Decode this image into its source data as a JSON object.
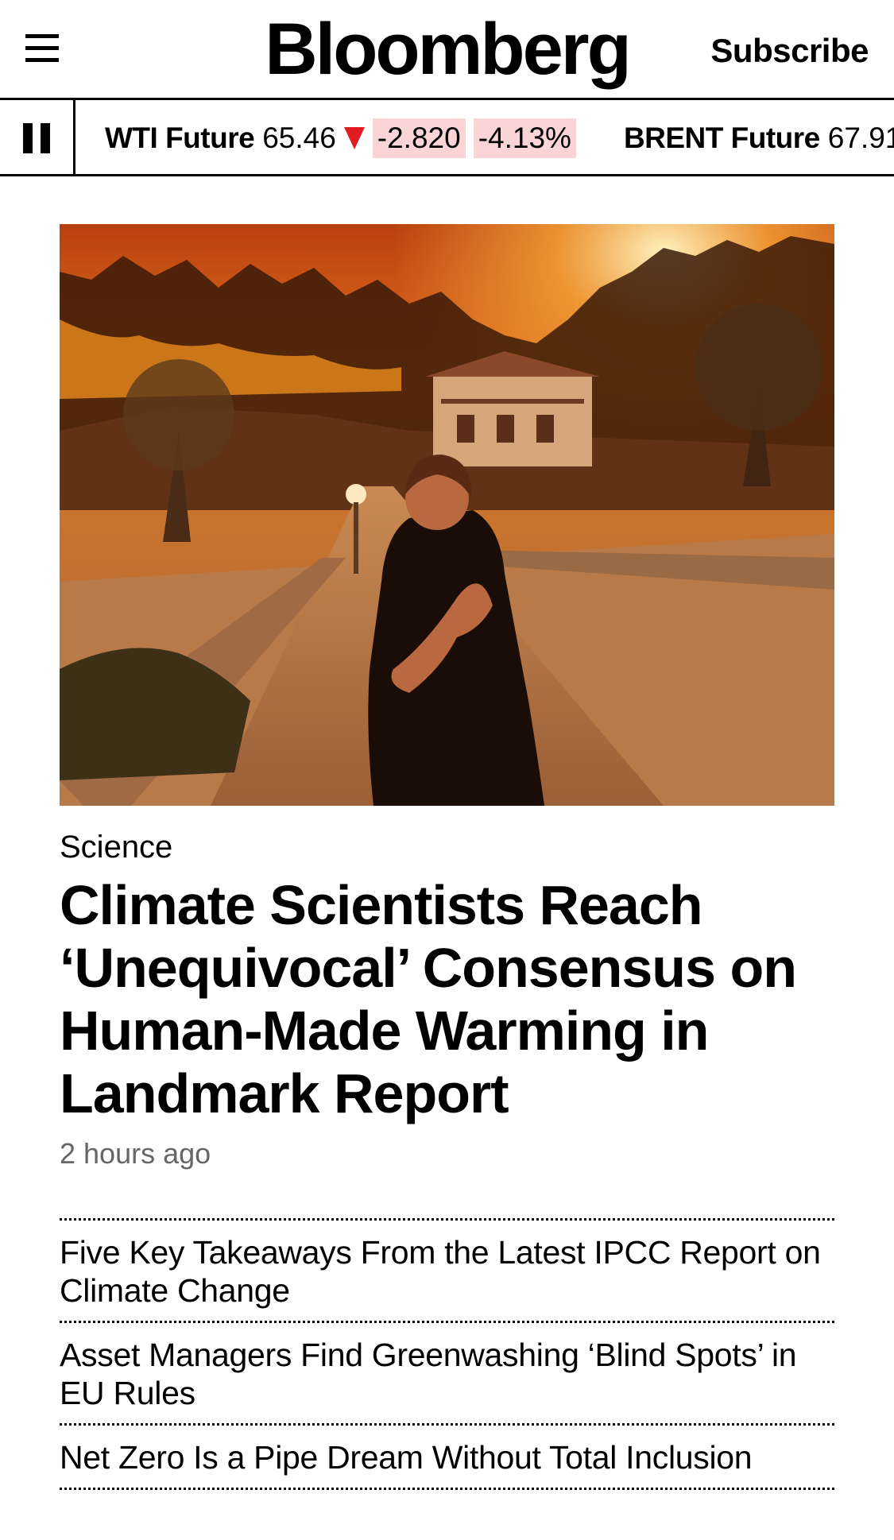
{
  "header": {
    "logo": "Bloomberg",
    "subscribe_label": "Subscribe",
    "menu_icon": "hamburger-menu-icon"
  },
  "ticker": {
    "pause_icon": "pause-icon",
    "quotes": [
      {
        "name": "WTI Future",
        "price": "65.46",
        "direction": "down",
        "change": "-2.820",
        "change_pct": "-4.13%"
      },
      {
        "name": "BRENT Future",
        "price": "67.91"
      }
    ],
    "colors": {
      "down": "#e31b23",
      "down_bg": "#fbd4d6"
    }
  },
  "article": {
    "section": "Science",
    "headline": "Climate Scientists Reach ‘Unequivocal’ Consensus on Human-Made Warming in Landmark Report",
    "timestamp": "2 hours ago"
  },
  "related": [
    {
      "title": "Five Key Takeaways From the Latest IPCC Report on Climate Change"
    },
    {
      "title": "Asset Managers Find Greenwashing ‘Blind Spots’ in EU Rules"
    },
    {
      "title": "Net Zero Is a Pipe Dream Without Total Inclusion"
    }
  ]
}
